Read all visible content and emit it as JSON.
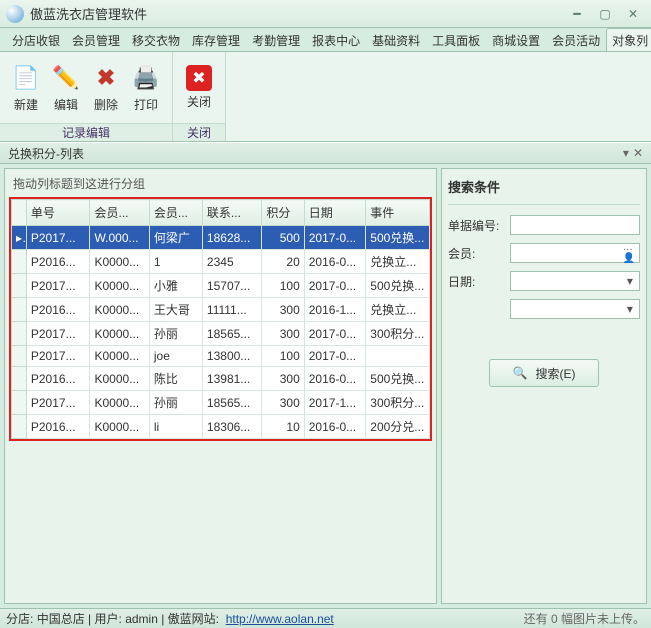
{
  "window": {
    "title": "傲蓝洗衣店管理软件"
  },
  "tabs": {
    "items": [
      "分店收银",
      "会员管理",
      "移交衣物",
      "库存管理",
      "考勤管理",
      "报表中心",
      "基础资料",
      "工具面板",
      "商城设置",
      "会员活动",
      "对象列"
    ],
    "active": 10
  },
  "ribbon": {
    "group1_label": "记录编辑",
    "group2_label": "关闭",
    "new": "新建",
    "edit": "编辑",
    "delete": "删除",
    "print": "打印",
    "close": "关闭"
  },
  "subheader": {
    "title": "兑换积分-列表"
  },
  "grid": {
    "hint": "拖动列标题到这进行分组",
    "columns": [
      "单号",
      "会员...",
      "会员...",
      "联系...",
      "积分",
      "日期",
      "事件"
    ],
    "rows": [
      {
        "c": [
          "P2017...",
          "W.000...",
          "何梁广",
          "18628...",
          "500",
          "2017-0...",
          "500兑换..."
        ],
        "sel": true
      },
      {
        "c": [
          "P2016...",
          "K0000...",
          "1",
          "2345",
          "20",
          "2016-0...",
          "兑换立..."
        ]
      },
      {
        "c": [
          "P2017...",
          "K0000...",
          "小雅",
          "15707...",
          "100",
          "2017-0...",
          "500兑换..."
        ]
      },
      {
        "c": [
          "P2016...",
          "K0000...",
          "王大哥",
          "11111...",
          "300",
          "2016-1...",
          "兑换立..."
        ]
      },
      {
        "c": [
          "P2017...",
          "K0000...",
          "孙丽",
          "18565...",
          "300",
          "2017-0...",
          "300积分..."
        ]
      },
      {
        "c": [
          "P2017...",
          "K0000...",
          "joe",
          "13800...",
          "100",
          "2017-0...",
          ""
        ]
      },
      {
        "c": [
          "P2016...",
          "K0000...",
          "陈比",
          "13981...",
          "300",
          "2016-0...",
          "500兑换..."
        ]
      },
      {
        "c": [
          "P2017...",
          "K0000...",
          "孙丽",
          "18565...",
          "300",
          "2017-1...",
          "300积分..."
        ]
      },
      {
        "c": [
          "P2016...",
          "K0000...",
          "li",
          "18306...",
          "10",
          "2016-0...",
          "200分兑..."
        ]
      }
    ]
  },
  "search": {
    "title": "搜索条件",
    "order_no_label": "单据编号:",
    "member_label": "会员:",
    "date_label": "日期:",
    "button": "搜索(E)"
  },
  "status": {
    "branch_label": "分店:",
    "branch": "中国总店",
    "user_label": "用户:",
    "user": "admin",
    "site_label": "傲蓝网站:",
    "site_url": "http://www.aolan.net",
    "upload": "还有 0 幅图片未上传。"
  }
}
